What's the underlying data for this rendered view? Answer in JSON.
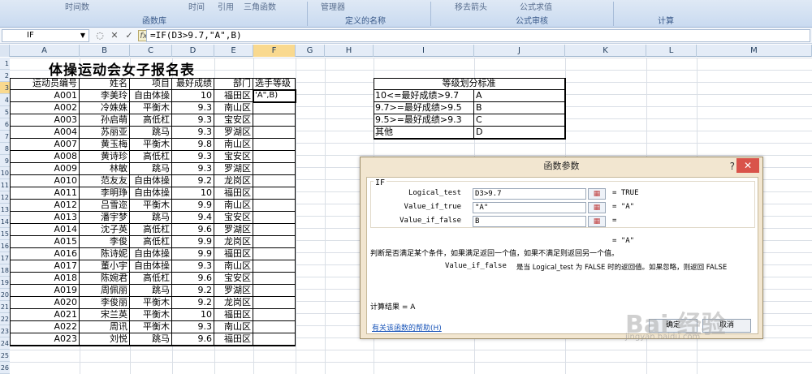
{
  "ribbon": {
    "top_items": [
      "时间数",
      "时间",
      "引用",
      "三角函数",
      "管理器",
      "移去箭头",
      "公式求值"
    ],
    "groups": [
      "函数库",
      "定义的名称",
      "公式审核",
      "计算"
    ]
  },
  "formula_bar": {
    "name_box": "IF",
    "formula": "=IF(D3>9.7,\"A\",B)"
  },
  "columns": [
    "A",
    "B",
    "C",
    "D",
    "E",
    "F",
    "G",
    "H",
    "I",
    "J",
    "K",
    "L",
    "M"
  ],
  "rows": [
    "1",
    "2",
    "3",
    "4",
    "5",
    "6",
    "7",
    "8",
    "9",
    "10",
    "11",
    "12",
    "13",
    "14",
    "15",
    "16",
    "17",
    "18",
    "19",
    "20",
    "21",
    "22",
    "23",
    "24",
    "25",
    "26"
  ],
  "sheet": {
    "title": "体操运动会女子报名表",
    "headers": [
      "运动员编号",
      "姓名",
      "项目",
      "最好成绩",
      "部门",
      "选手等级"
    ],
    "active_cell_text": "'A\",B)",
    "records": [
      [
        "A001",
        "李美玲",
        "自由体操",
        "10",
        "福田区"
      ],
      [
        "A002",
        "冷姝姝",
        "平衡木",
        "9.3",
        "南山区"
      ],
      [
        "A003",
        "孙启萌",
        "高低杠",
        "9.3",
        "宝安区"
      ],
      [
        "A004",
        "苏丽亚",
        "跳马",
        "9.3",
        "罗湖区"
      ],
      [
        "A007",
        "黄玉梅",
        "平衡木",
        "9.8",
        "南山区"
      ],
      [
        "A008",
        "黄诗珍",
        "高低杠",
        "9.3",
        "宝安区"
      ],
      [
        "A009",
        "林敏",
        "跳马",
        "9.3",
        "罗湖区"
      ],
      [
        "A010",
        "范友友",
        "自由体操",
        "9.2",
        "龙岗区"
      ],
      [
        "A011",
        "李明琤",
        "自由体操",
        "10",
        "福田区"
      ],
      [
        "A012",
        "吕雪迩",
        "平衡木",
        "9.9",
        "南山区"
      ],
      [
        "A013",
        "潘宇梦",
        "跳马",
        "9.4",
        "宝安区"
      ],
      [
        "A014",
        "沈子英",
        "高低杠",
        "9.6",
        "罗湖区"
      ],
      [
        "A015",
        "李俊",
        "高低杠",
        "9.9",
        "龙岗区"
      ],
      [
        "A016",
        "陈诗妮",
        "自由体操",
        "9.9",
        "福田区"
      ],
      [
        "A017",
        "董小宇",
        "自由体操",
        "9.3",
        "南山区"
      ],
      [
        "A018",
        "陈婉君",
        "高低杠",
        "9.6",
        "宝安区"
      ],
      [
        "A019",
        "周佩丽",
        "跳马",
        "9.2",
        "罗湖区"
      ],
      [
        "A020",
        "李俊丽",
        "平衡木",
        "9.2",
        "龙岗区"
      ],
      [
        "A021",
        "宋兰英",
        "平衡木",
        "10",
        "福田区"
      ],
      [
        "A022",
        "周讯",
        "平衡木",
        "9.3",
        "南山区"
      ],
      [
        "A023",
        "刘悦",
        "跳马",
        "9.6",
        "福田区"
      ]
    ]
  },
  "grade_table": {
    "title": "等级划分标准",
    "rows": [
      [
        "10<=最好成绩>9.7",
        "A"
      ],
      [
        "9.7>=最好成绩>9.5",
        "B"
      ],
      [
        "9.5>=最好成绩>9.3",
        "C"
      ],
      [
        "其他",
        "D"
      ]
    ]
  },
  "dialog": {
    "title": "函数参数",
    "help_glyph": "?",
    "close_glyph": "✕",
    "function_name": "IF",
    "args": [
      {
        "label": "Logical_test",
        "value": "D3>9.7",
        "result": "= TRUE"
      },
      {
        "label": "Value_if_true",
        "value": "\"A\"",
        "result": "= \"A\""
      },
      {
        "label": "Value_if_false",
        "value": "B",
        "result": "="
      }
    ],
    "overall_result": "= \"A\"",
    "description": "判断是否满足某个条件，如果满足返回一个值，如果不满足则返回另一个值。",
    "arg_help_name": "Value_if_false",
    "arg_help_text": "是当 Logical_test 为 FALSE 时的返回值。如果忽略，则返回 FALSE",
    "calc_result": "计算结果 = A",
    "help_link": "有关该函数的帮助(H)",
    "ok_label": "确定",
    "cancel_label": "取消"
  },
  "watermark": {
    "brand": "Bai 经验",
    "url": "jingyan.baidu.com"
  }
}
